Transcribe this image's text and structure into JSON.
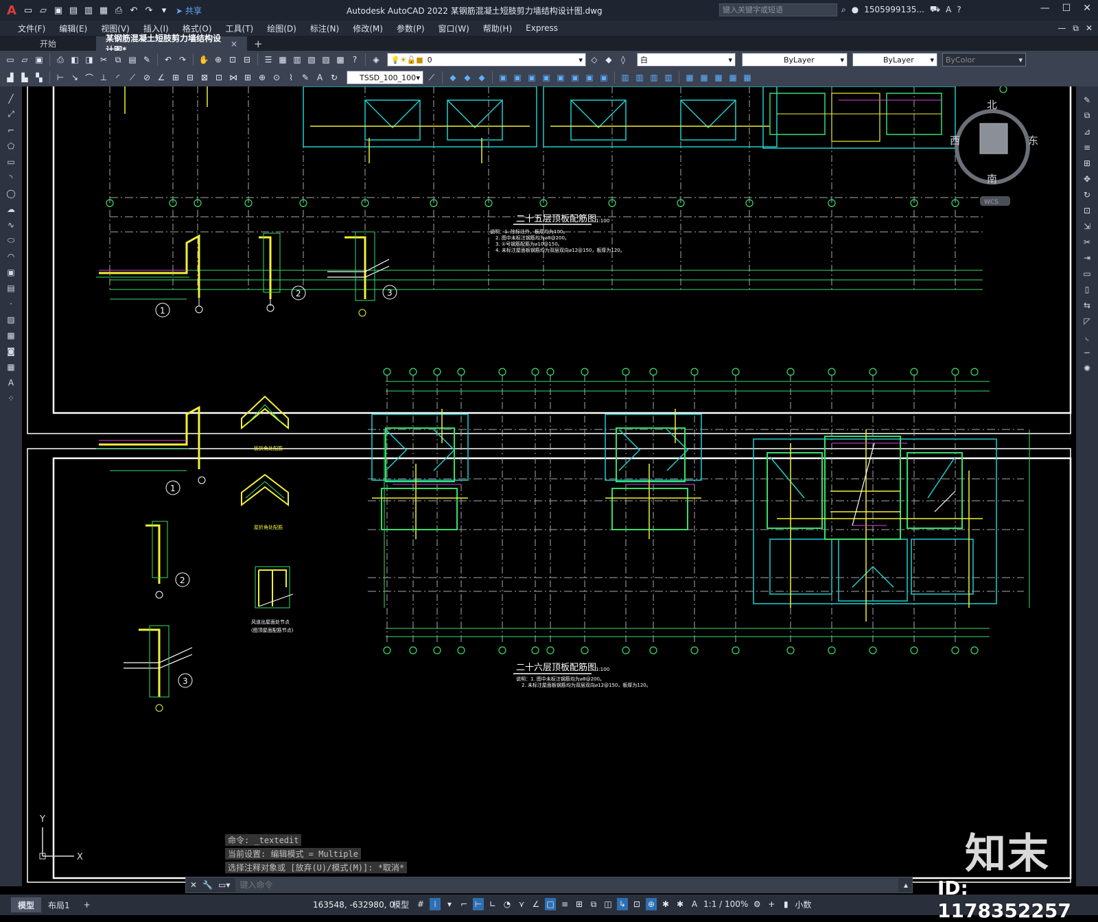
{
  "app": {
    "title": "Autodesk AutoCAD 2022    某钢筋混凝土短肢剪力墙结构设计图.dwg",
    "share_label": "共享",
    "search_placeholder": "键入关键字或短语",
    "user": "1505999135...",
    "logo": "A"
  },
  "menu": [
    "文件(F)",
    "编辑(E)",
    "视图(V)",
    "插入(I)",
    "格式(O)",
    "工具(T)",
    "绘图(D)",
    "标注(N)",
    "修改(M)",
    "参数(P)",
    "窗口(W)",
    "帮助(H)",
    "Express"
  ],
  "tabs": {
    "start": "开始",
    "active": "某钢筋混凝土短肢剪力墙结构设计图*",
    "close": "×",
    "plus": "+"
  },
  "toolbar": {
    "layer_value": "0",
    "color_value": "白",
    "linetype_value": "ByLayer",
    "lineweight_value": "ByLayer",
    "plotstyle_value": "ByColor",
    "dimstyle_value": "TSSD_100_100"
  },
  "viewcube": {
    "north": "北",
    "south": "南",
    "east": "东",
    "west": "西",
    "wcs": "WCS"
  },
  "drawing": {
    "plan25_title": "二十五层顶板配筋图",
    "plan25_scale": "1:100",
    "plan25_notes": [
      "说明：1. 除标注外，板厚均为100。",
      "2. 图中未标注钢筋均为⌀8@200。",
      "3. ①号钢筋配筋为⌀10@150。",
      "4. 未标注屋面板钢筋均为双层双向⌀12@150，板厚为120。"
    ],
    "plan26_title": "二十六层顶板配筋图",
    "plan26_scale": "1:100",
    "plan26_notes": [
      "说明：1. 图中未标注钢筋均为⌀8@200。",
      "2. 未标注屋面板钢筋均为双层双向⌀12@150，板厚为120。"
    ],
    "detail_labels": [
      "1",
      "2",
      "3"
    ],
    "detail_captions": [
      "板折角处配筋",
      "屋折角处配筋",
      "风道出屋面处节点",
      "(图顶屋面配筋节点)"
    ],
    "ucs": {
      "x": "X",
      "y": "Y"
    }
  },
  "command": {
    "history": [
      "命令: _textedit",
      "当前设置: 编辑模式 = Multiple",
      "选择注释对象或 [放弃(U)/模式(M)]: *取消*"
    ],
    "placeholder": "键入命令"
  },
  "status": {
    "tabs": [
      "模型",
      "布局1"
    ],
    "plus": "+",
    "coords": "163548, -632980, 0",
    "model_label": "模型",
    "scale": "1:1 / 100%",
    "units": "小数"
  },
  "watermark": {
    "brand": "知末",
    "id": "ID: 1178352257"
  }
}
